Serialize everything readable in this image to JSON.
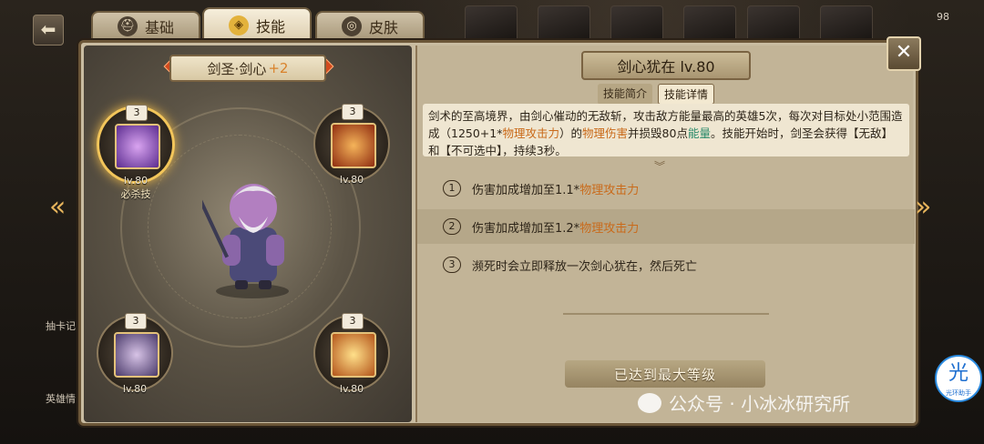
{
  "tabs": [
    {
      "label": "基础",
      "icon": "helmet-icon"
    },
    {
      "label": "技能",
      "icon": "skill-emblem-icon"
    },
    {
      "label": "皮肤",
      "icon": "mask-icon"
    }
  ],
  "level_badge": "98",
  "left": {
    "title": "剑圣·剑心",
    "title_plus": "+2",
    "skills": [
      {
        "count": "3",
        "level": "lv.80",
        "tag": "必杀技",
        "color": "#7a4bb8"
      },
      {
        "count": "3",
        "level": "lv.80",
        "tag": "",
        "color": "#c2521c"
      },
      {
        "count": "3",
        "level": "lv.80",
        "tag": "",
        "color": "#8a6a9c"
      },
      {
        "count": "3",
        "level": "lv.80",
        "tag": "",
        "color": "#d98a2a"
      }
    ]
  },
  "right": {
    "title": "剑心犹在 lv.80",
    "tab_intro": "技能简介",
    "tab_detail": "技能详情",
    "desc_a": "剑术的至高境界，由剑心催动的无敌斩，攻击敌方能量最高的英雄5次，每次对目标处小范围造成（1250+1*",
    "desc_phys_atk": "物理攻击力",
    "desc_b": "）的",
    "desc_phys_dmg": "物理伤害",
    "desc_c": "并损毁80点",
    "desc_energy": "能量",
    "desc_d": "。技能开始时，剑圣会获得【无敌】和【不可选中】，持续3秒。",
    "upgrades": [
      {
        "num": "1",
        "text": "伤害加成增加至1.1*",
        "highlight": "物理攻击力"
      },
      {
        "num": "2",
        "text": "伤害加成增加至1.2*",
        "highlight": "物理攻击力"
      },
      {
        "num": "3",
        "text": "濒死时会立即释放一次剑心犹在，然后死亡",
        "highlight": ""
      }
    ],
    "max_level": "已达到最大等级"
  },
  "close_label": "✕",
  "side_labels": [
    "英雄情",
    "抽卡记"
  ],
  "watermark": "公众号 · 小冰冰研究所",
  "helper": {
    "glyph": "光",
    "sub": "光环助手"
  }
}
